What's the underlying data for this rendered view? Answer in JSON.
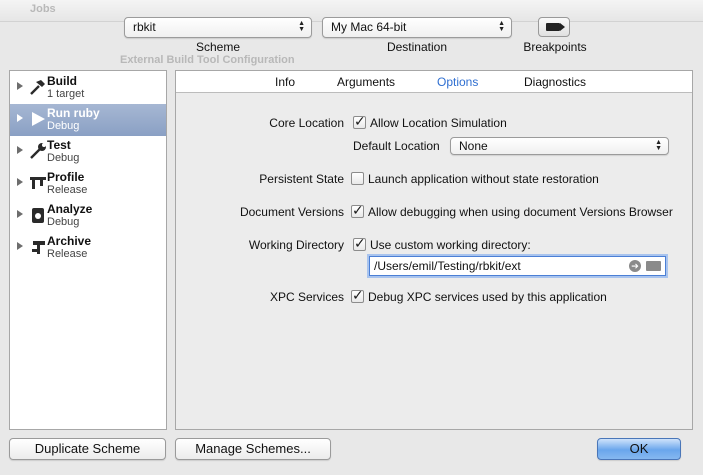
{
  "window": {
    "bg_title": "Jobs",
    "bg_section": "External Build Tool Configuration"
  },
  "toolbar": {
    "scheme": {
      "value": "rbkit",
      "label": "Scheme"
    },
    "destination": {
      "value": "My Mac 64-bit",
      "label": "Destination"
    },
    "breakpoints": {
      "label": "Breakpoints"
    }
  },
  "sidebar": {
    "items": [
      {
        "title": "Build",
        "subtitle": "1 target",
        "icon": "hammer-icon",
        "selected": false
      },
      {
        "title": "Run ruby",
        "subtitle": "Debug",
        "icon": "play-icon",
        "selected": true
      },
      {
        "title": "Test",
        "subtitle": "Debug",
        "icon": "wrench-icon",
        "selected": false
      },
      {
        "title": "Profile",
        "subtitle": "Release",
        "icon": "caliper-icon",
        "selected": false
      },
      {
        "title": "Analyze",
        "subtitle": "Debug",
        "icon": "analyze-icon",
        "selected": false
      },
      {
        "title": "Archive",
        "subtitle": "Release",
        "icon": "archive-icon",
        "selected": false
      }
    ]
  },
  "tabs": [
    {
      "label": "Info",
      "active": false
    },
    {
      "label": "Arguments",
      "active": false
    },
    {
      "label": "Options",
      "active": true
    },
    {
      "label": "Diagnostics",
      "active": false
    }
  ],
  "options": {
    "core_location": {
      "label": "Core Location",
      "checkbox": "Allow Location Simulation",
      "checked": true
    },
    "default_location": {
      "label": "Default Location",
      "value": "None"
    },
    "persistent_state": {
      "label": "Persistent State",
      "checkbox": "Launch application without state restoration",
      "checked": false
    },
    "document_versions": {
      "label": "Document Versions",
      "checkbox": "Allow debugging when using document Versions Browser",
      "checked": true
    },
    "working_directory": {
      "label": "Working Directory",
      "checkbox": "Use custom working directory:",
      "checked": true,
      "path": "/Users/emil/Testing/rbkit/ext"
    },
    "xpc_services": {
      "label": "XPC Services",
      "checkbox": "Debug XPC services used by this application",
      "checked": true
    }
  },
  "buttons": {
    "duplicate": "Duplicate Scheme",
    "manage": "Manage Schemes...",
    "ok": "OK"
  },
  "colors": {
    "accent": "#2f6fd1",
    "selection": "#8aa0c4"
  }
}
